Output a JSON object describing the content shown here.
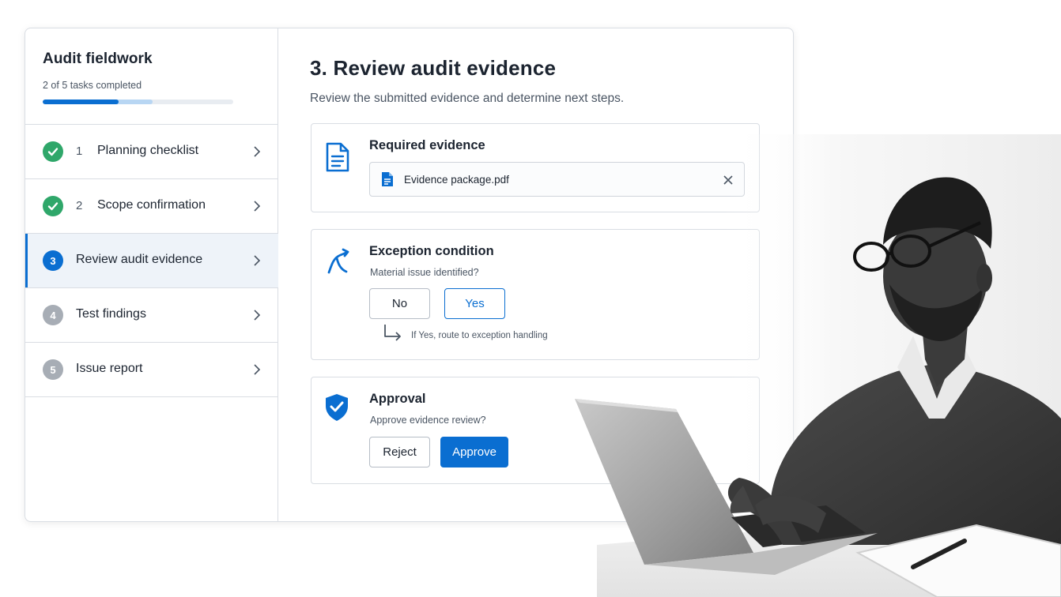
{
  "colors": {
    "accent": "#0a6ed1",
    "success": "#2fa76a",
    "pending": "#a7adb5",
    "border": "#d9dde3"
  },
  "sidebar": {
    "title": "Audit fieldwork",
    "progress_text": "2 of 5 tasks completed",
    "progress_completed": 2,
    "progress_total": 5,
    "steps": [
      {
        "number": "1",
        "label": "Planning checklist",
        "state": "done",
        "icon": "check-icon"
      },
      {
        "number": "2",
        "label": "Scope confirmation",
        "state": "done",
        "icon": "check-icon"
      },
      {
        "number": "3",
        "label": "Review audit evidence",
        "state": "current"
      },
      {
        "number": "4",
        "label": "Test findings",
        "state": "pending"
      },
      {
        "number": "5",
        "label": "Issue report",
        "state": "pending"
      }
    ]
  },
  "main": {
    "title": "3. Review audit evidence",
    "subtitle": "Review the submitted evidence and determine next steps.",
    "required_evidence": {
      "title": "Required evidence",
      "icon": "document-icon",
      "file": {
        "name": "Evidence package.pdf",
        "icon": "pdf-file-icon",
        "remove_icon": "close-icon"
      }
    },
    "exception": {
      "title": "Exception condition",
      "icon": "branch-route-icon",
      "question": "Material issue identified?",
      "no_label": "No",
      "yes_label": "Yes",
      "hint": "If Yes, route to exception handling",
      "hint_icon": "return-arrow-icon"
    },
    "approval": {
      "title": "Approval",
      "icon": "shield-check-icon",
      "question": "Approve evidence review?",
      "reject_label": "Reject",
      "approve_label": "Approve"
    }
  }
}
